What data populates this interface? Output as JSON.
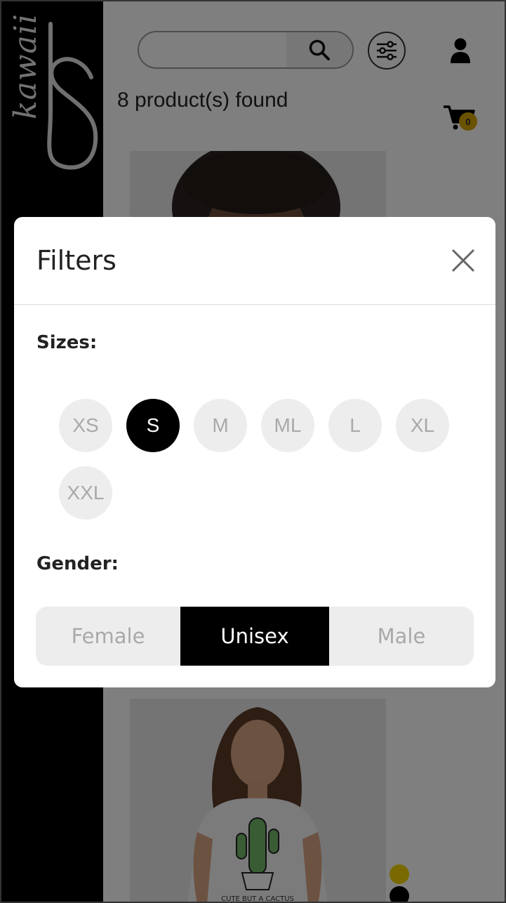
{
  "brand": {
    "name": "kawaii",
    "monogram": "S"
  },
  "header": {
    "search_placeholder": "",
    "search_icon": "search-icon",
    "filter_icon": "sliders-icon",
    "user_icon": "user-icon"
  },
  "results": {
    "count_text": "8 product(s) found"
  },
  "cart": {
    "icon": "cart-icon",
    "count": "0",
    "badge_color": "#d5a500"
  },
  "colors": {
    "yellow": "#f5d200",
    "black": "#000000"
  },
  "modal": {
    "title": "Filters",
    "close_icon": "close-icon",
    "sizes_label": "Sizes:",
    "sizes": [
      {
        "label": "XS",
        "selected": false
      },
      {
        "label": "S",
        "selected": true
      },
      {
        "label": "M",
        "selected": false
      },
      {
        "label": "ML",
        "selected": false
      },
      {
        "label": "L",
        "selected": false
      },
      {
        "label": "XL",
        "selected": false
      },
      {
        "label": "XXL",
        "selected": false
      }
    ],
    "gender_label": "Gender:",
    "genders": [
      {
        "label": "Female",
        "selected": false
      },
      {
        "label": "Unisex",
        "selected": true
      },
      {
        "label": "Male",
        "selected": false
      }
    ]
  },
  "products": [
    {
      "image": "woman-curly-hair-photo"
    },
    {
      "image": "woman-cactus-tshirt-photo",
      "shirt_text": "CUTE BUT A CACTUS"
    }
  ]
}
